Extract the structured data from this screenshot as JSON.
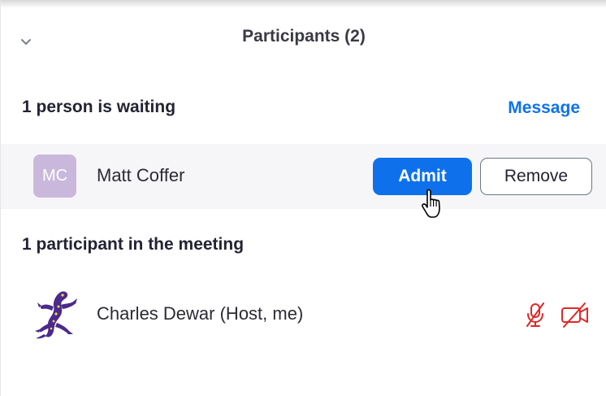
{
  "header": {
    "title": "Participants (2)",
    "collapse_icon": "chevron-down-icon"
  },
  "waiting_room": {
    "label": "1 person is waiting",
    "message_label": "Message",
    "participants": [
      {
        "initials": "MC",
        "name": "Matt Coffer",
        "avatar_color": "#cab8dc",
        "admit_label": "Admit",
        "remove_label": "Remove"
      }
    ]
  },
  "meeting": {
    "label": "1 participant in the meeting",
    "participants": [
      {
        "name": "Charles Dewar (Host, me)",
        "avatar": "purple-lizard-avatar",
        "mic_icon": "mic-muted-icon",
        "video_icon": "video-off-icon"
      }
    ]
  },
  "colors": {
    "accent": "#0e71eb",
    "link": "#0e72ed",
    "muted_red": "#e02828",
    "row_highlight": "#f6f6f8"
  }
}
